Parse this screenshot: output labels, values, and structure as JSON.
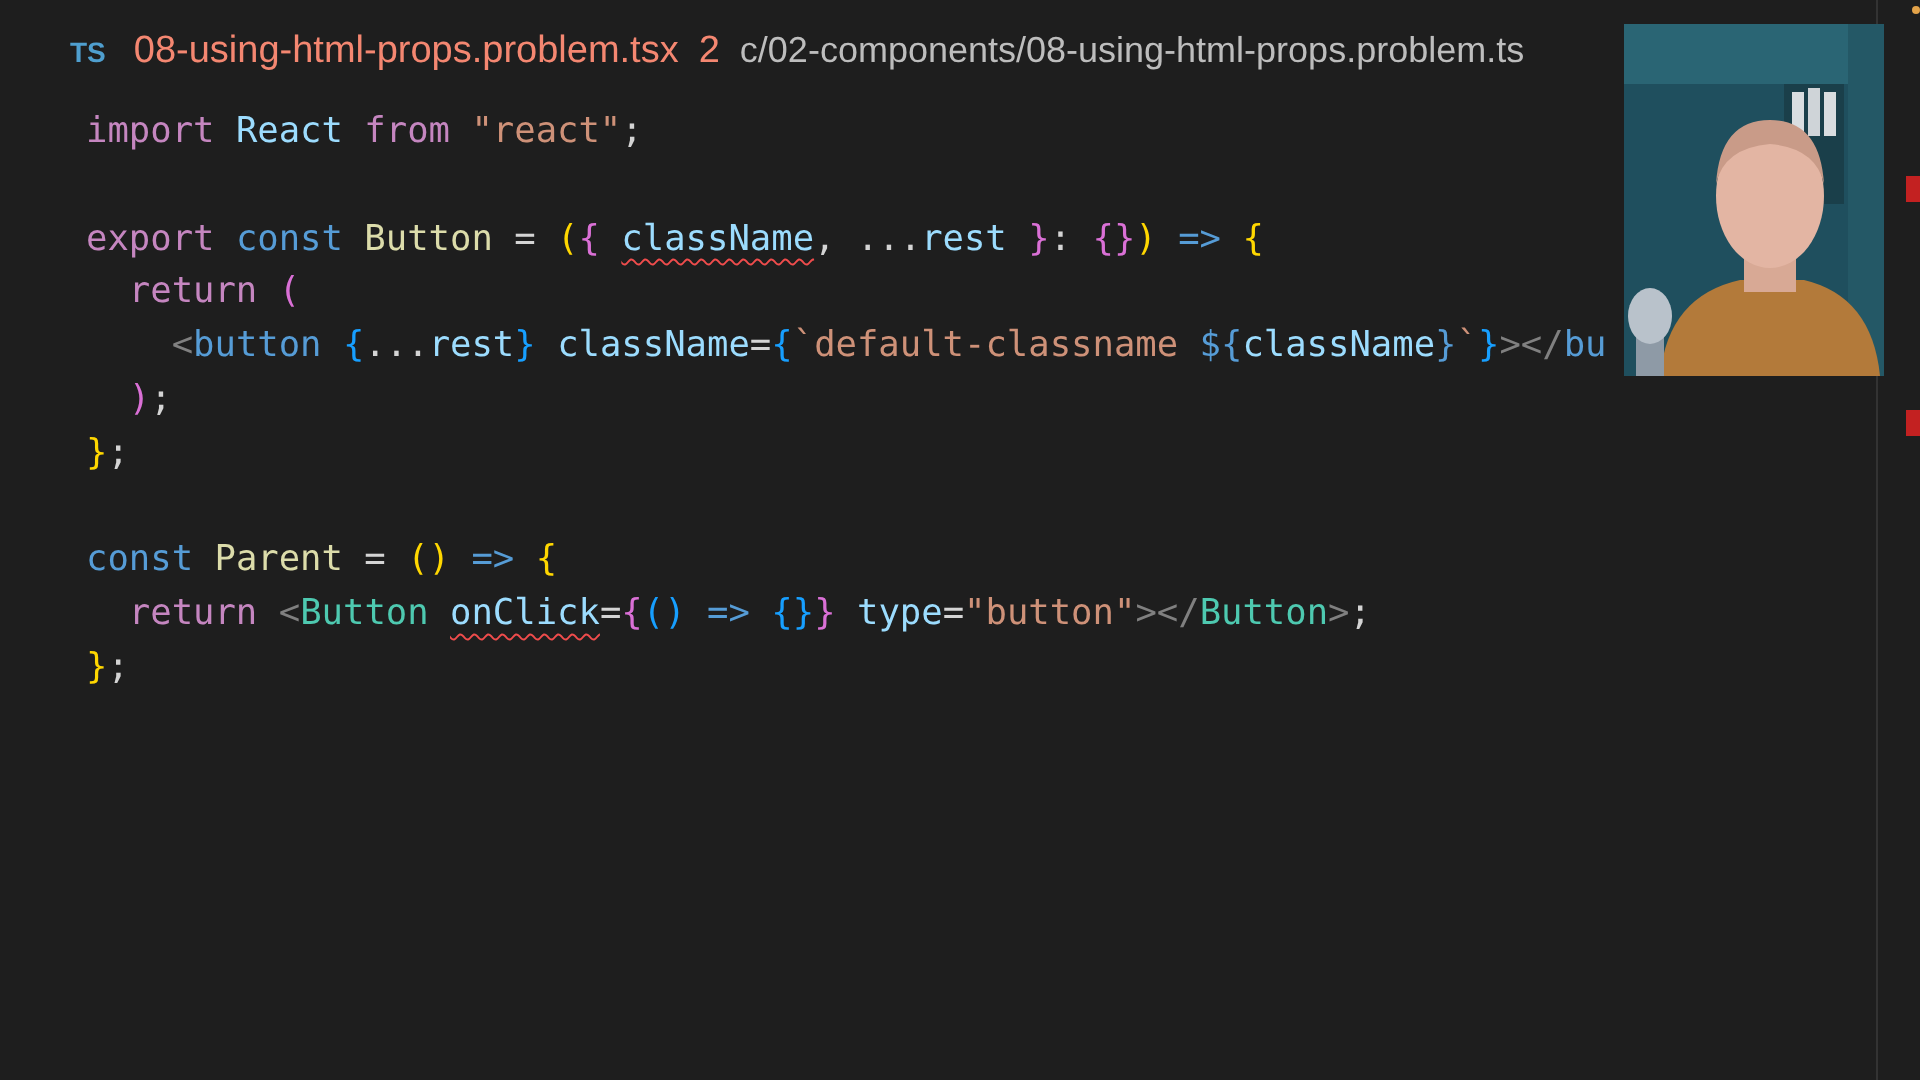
{
  "tab": {
    "language_badge": "TS",
    "filename": "08-using-html-props.problem.tsx",
    "problem_count": "2",
    "path": "c/02-components/08-using-html-props.problem.ts"
  },
  "code_lines": [
    {
      "tokens": [
        {
          "text": "import",
          "kind": "keyword"
        },
        {
          "text": " React",
          "kind": "variable"
        },
        {
          "text": " from",
          "kind": "keyword"
        },
        {
          "text": " \"react\"",
          "kind": "string"
        },
        {
          "text": ";",
          "kind": "plain"
        }
      ]
    },
    {
      "kind": "blank"
    },
    {
      "tokens": [
        {
          "text": "export",
          "kind": "keyword"
        },
        {
          "text": " const",
          "kind": "storage"
        },
        {
          "text": " Button",
          "kind": "function"
        },
        {
          "text": " = ",
          "kind": "plain"
        },
        {
          "text": "(",
          "kind": "bracket1"
        },
        {
          "text": "{ ",
          "kind": "bracket2"
        },
        {
          "text": "className",
          "kind": "variable",
          "error": true
        },
        {
          "text": ", ...",
          "kind": "plain"
        },
        {
          "text": "rest",
          "kind": "variable"
        },
        {
          "text": " }",
          "kind": "bracket2"
        },
        {
          "text": ": ",
          "kind": "plain"
        },
        {
          "text": "{}",
          "kind": "bracket2"
        },
        {
          "text": ")",
          "kind": "bracket1"
        },
        {
          "text": " =>",
          "kind": "storage"
        },
        {
          "text": " {",
          "kind": "bracket1"
        }
      ]
    },
    {
      "tokens": [
        {
          "text": "  return",
          "kind": "keyword"
        },
        {
          "text": " (",
          "kind": "bracket2"
        }
      ]
    },
    {
      "tokens": [
        {
          "text": "    <",
          "kind": "tag"
        },
        {
          "text": "button",
          "kind": "storage"
        },
        {
          "text": " {",
          "kind": "bracket3"
        },
        {
          "text": "...",
          "kind": "plain"
        },
        {
          "text": "rest",
          "kind": "variable"
        },
        {
          "text": "}",
          "kind": "bracket3"
        },
        {
          "text": " className",
          "kind": "variable"
        },
        {
          "text": "=",
          "kind": "plain"
        },
        {
          "text": "{",
          "kind": "bracket3"
        },
        {
          "text": "`default-classname ",
          "kind": "string"
        },
        {
          "text": "${",
          "kind": "storage"
        },
        {
          "text": "className",
          "kind": "variable"
        },
        {
          "text": "}",
          "kind": "storage"
        },
        {
          "text": "`",
          "kind": "string"
        },
        {
          "text": "}",
          "kind": "bracket3"
        },
        {
          "text": "></",
          "kind": "tag"
        },
        {
          "text": "bu",
          "kind": "storage"
        }
      ]
    },
    {
      "tokens": [
        {
          "text": "  )",
          "kind": "bracket2"
        },
        {
          "text": ";",
          "kind": "plain"
        }
      ]
    },
    {
      "tokens": [
        {
          "text": "}",
          "kind": "bracket1"
        },
        {
          "text": ";",
          "kind": "plain"
        }
      ]
    },
    {
      "kind": "blank"
    },
    {
      "tokens": [
        {
          "text": "const",
          "kind": "storage"
        },
        {
          "text": " Parent",
          "kind": "function"
        },
        {
          "text": " = ",
          "kind": "plain"
        },
        {
          "text": "()",
          "kind": "bracket1"
        },
        {
          "text": " =>",
          "kind": "storage"
        },
        {
          "text": " {",
          "kind": "bracket1"
        }
      ]
    },
    {
      "tokens": [
        {
          "text": "  return",
          "kind": "keyword"
        },
        {
          "text": " <",
          "kind": "tag"
        },
        {
          "text": "Button ",
          "kind": "component"
        },
        {
          "text": "onClick",
          "kind": "variable",
          "error": true
        },
        {
          "text": "=",
          "kind": "plain"
        },
        {
          "text": "{",
          "kind": "bracket2"
        },
        {
          "text": "()",
          "kind": "bracket3"
        },
        {
          "text": " =>",
          "kind": "storage"
        },
        {
          "text": " {}",
          "kind": "bracket3"
        },
        {
          "text": "}",
          "kind": "bracket2"
        },
        {
          "text": " type",
          "kind": "variable"
        },
        {
          "text": "=",
          "kind": "plain"
        },
        {
          "text": "\"button\"",
          "kind": "string"
        },
        {
          "text": "></",
          "kind": "tag"
        },
        {
          "text": "Button",
          "kind": "component"
        },
        {
          "text": ">",
          "kind": "tag"
        },
        {
          "text": ";",
          "kind": "plain"
        }
      ]
    },
    {
      "tokens": [
        {
          "text": "}",
          "kind": "bracket1"
        },
        {
          "text": ";",
          "kind": "plain"
        }
      ]
    }
  ]
}
